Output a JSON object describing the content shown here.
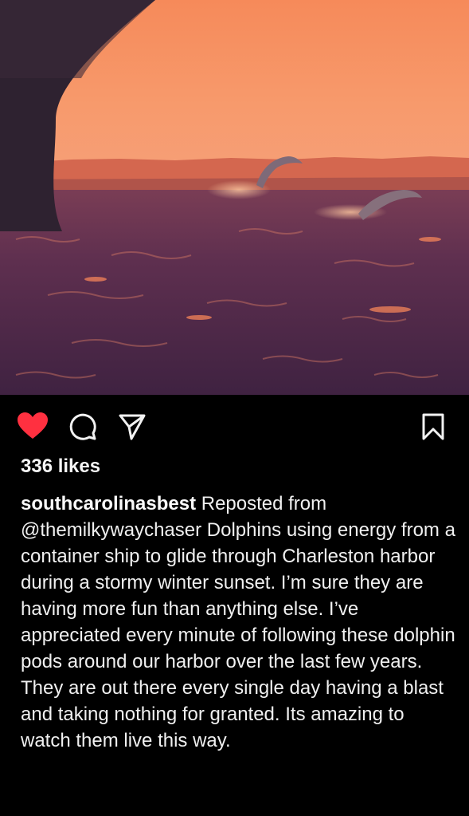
{
  "post": {
    "image_alt": "Dolphins leaping in the wake of a container ship at sunset in Charleston harbor",
    "likes_text": "336 likes",
    "caption": {
      "username": "southcarolinasbest",
      "intro": " Reposted from ",
      "mention": "@themilkywaychaser",
      "body": " Dolphins using energy from a container ship to glide through Charleston harbor during a stormy winter sunset.  I’m sure they are having more fun than anything else.  I’ve appreciated every minute of following these dolphin pods around our harbor over the last few years.  They are out there every single day having a blast and taking nothing for granted.  Its amazing to watch them live this way."
    }
  },
  "actions": {
    "like": {
      "icon": "heart-icon",
      "liked": true,
      "color": "#ff3040"
    },
    "comment": {
      "icon": "comment-icon"
    },
    "share": {
      "icon": "share-icon"
    },
    "save": {
      "icon": "bookmark-icon"
    }
  },
  "colors": {
    "background": "#000000",
    "text": "#f2f2f2",
    "like_red": "#ff3040"
  }
}
